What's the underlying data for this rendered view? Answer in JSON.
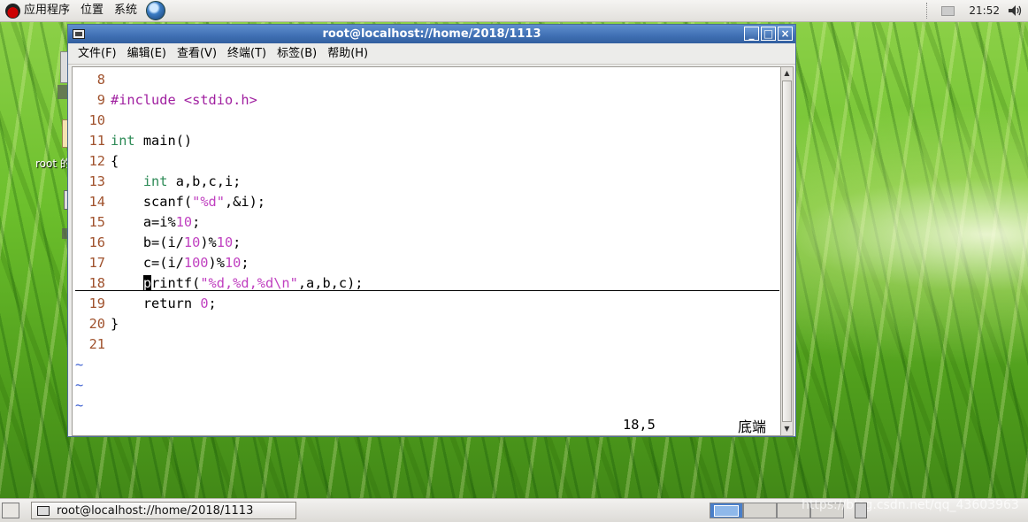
{
  "top_panel": {
    "applications": "应用程序",
    "places": "位置",
    "system": "系统",
    "clock": "21:52"
  },
  "desktop": {
    "home_icon_label": "root 的"
  },
  "window": {
    "title": "root@localhost://home/2018/1113",
    "menu": [
      "文件(F)",
      "编辑(E)",
      "查看(V)",
      "终端(T)",
      "标签(B)",
      "帮助(H)"
    ],
    "buttons": {
      "minimize": "_",
      "maximize": "□",
      "close": "×"
    }
  },
  "editor": {
    "lines": [
      {
        "num": "8",
        "code": ""
      },
      {
        "num": "9",
        "code": "#include <stdio.h>"
      },
      {
        "num": "10",
        "code": ""
      },
      {
        "num": "11",
        "code": "int main()"
      },
      {
        "num": "12",
        "code": "{"
      },
      {
        "num": "13",
        "code": "    int a,b,c,i;"
      },
      {
        "num": "14",
        "code": "    scanf(\"%d\",&i);"
      },
      {
        "num": "15",
        "code": "    a=i%10;"
      },
      {
        "num": "16",
        "code": "    b=(i/10)%10;"
      },
      {
        "num": "17",
        "code": "    c=(i/100)%10;"
      },
      {
        "num": "18",
        "code": "    printf(\"%d,%d,%d\\n\",a,b,c);"
      },
      {
        "num": "19",
        "code": "    return 0;"
      },
      {
        "num": "20",
        "code": "}"
      },
      {
        "num": "21",
        "code": ""
      }
    ],
    "tildes": [
      "~",
      "~",
      "~"
    ],
    "cursor_position": "18,5",
    "scroll_status": "底端"
  },
  "bottom_panel": {
    "task_label": "root@localhost://home/2018/1113",
    "watermark": "https://blog.csdn.net/qq_43603963"
  }
}
